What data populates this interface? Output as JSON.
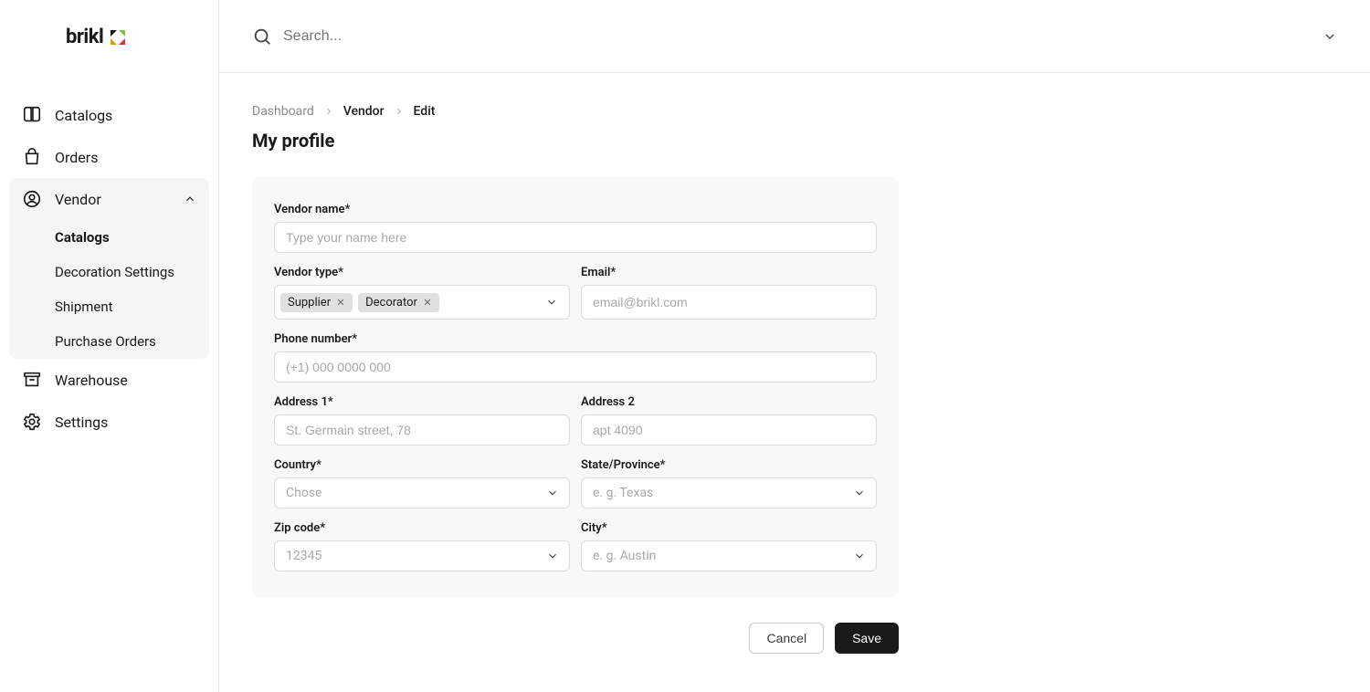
{
  "brand": {
    "name": "brikl"
  },
  "nav": {
    "items": [
      {
        "label": "Catalogs"
      },
      {
        "label": "Orders"
      },
      {
        "label": "Vendor"
      },
      {
        "label": "Warehouse"
      },
      {
        "label": "Settings"
      }
    ],
    "vendor_sub": [
      {
        "label": "Catalogs"
      },
      {
        "label": "Decoration Settings"
      },
      {
        "label": "Shipment"
      },
      {
        "label": "Purchase Orders"
      }
    ]
  },
  "topbar": {
    "search_placeholder": "Search..."
  },
  "breadcrumb": {
    "items": [
      "Dashboard",
      "Vendor",
      "Edit"
    ]
  },
  "page": {
    "title": "My profile"
  },
  "form": {
    "vendor_name": {
      "label": "Vendor name*",
      "placeholder": "Type your name here"
    },
    "vendor_type": {
      "label": "Vendor type*",
      "tags": [
        "Supplier",
        "Decorator"
      ]
    },
    "email": {
      "label": "Email*",
      "placeholder": "email@brikl.com"
    },
    "phone": {
      "label": "Phone number*",
      "placeholder": "(+1) 000 0000 000"
    },
    "address1": {
      "label": "Address 1*",
      "placeholder": "St. Germain street, 78"
    },
    "address2": {
      "label": "Address 2",
      "placeholder": "apt 4090"
    },
    "country": {
      "label": "Country*",
      "placeholder": "Chose"
    },
    "state": {
      "label": "State/Province*",
      "placeholder": "e. g. Texas"
    },
    "zip": {
      "label": "Zip code*",
      "placeholder": "12345"
    },
    "city": {
      "label": "City*",
      "placeholder": "e. g. Austin"
    }
  },
  "actions": {
    "cancel": "Cancel",
    "save": "Save"
  }
}
